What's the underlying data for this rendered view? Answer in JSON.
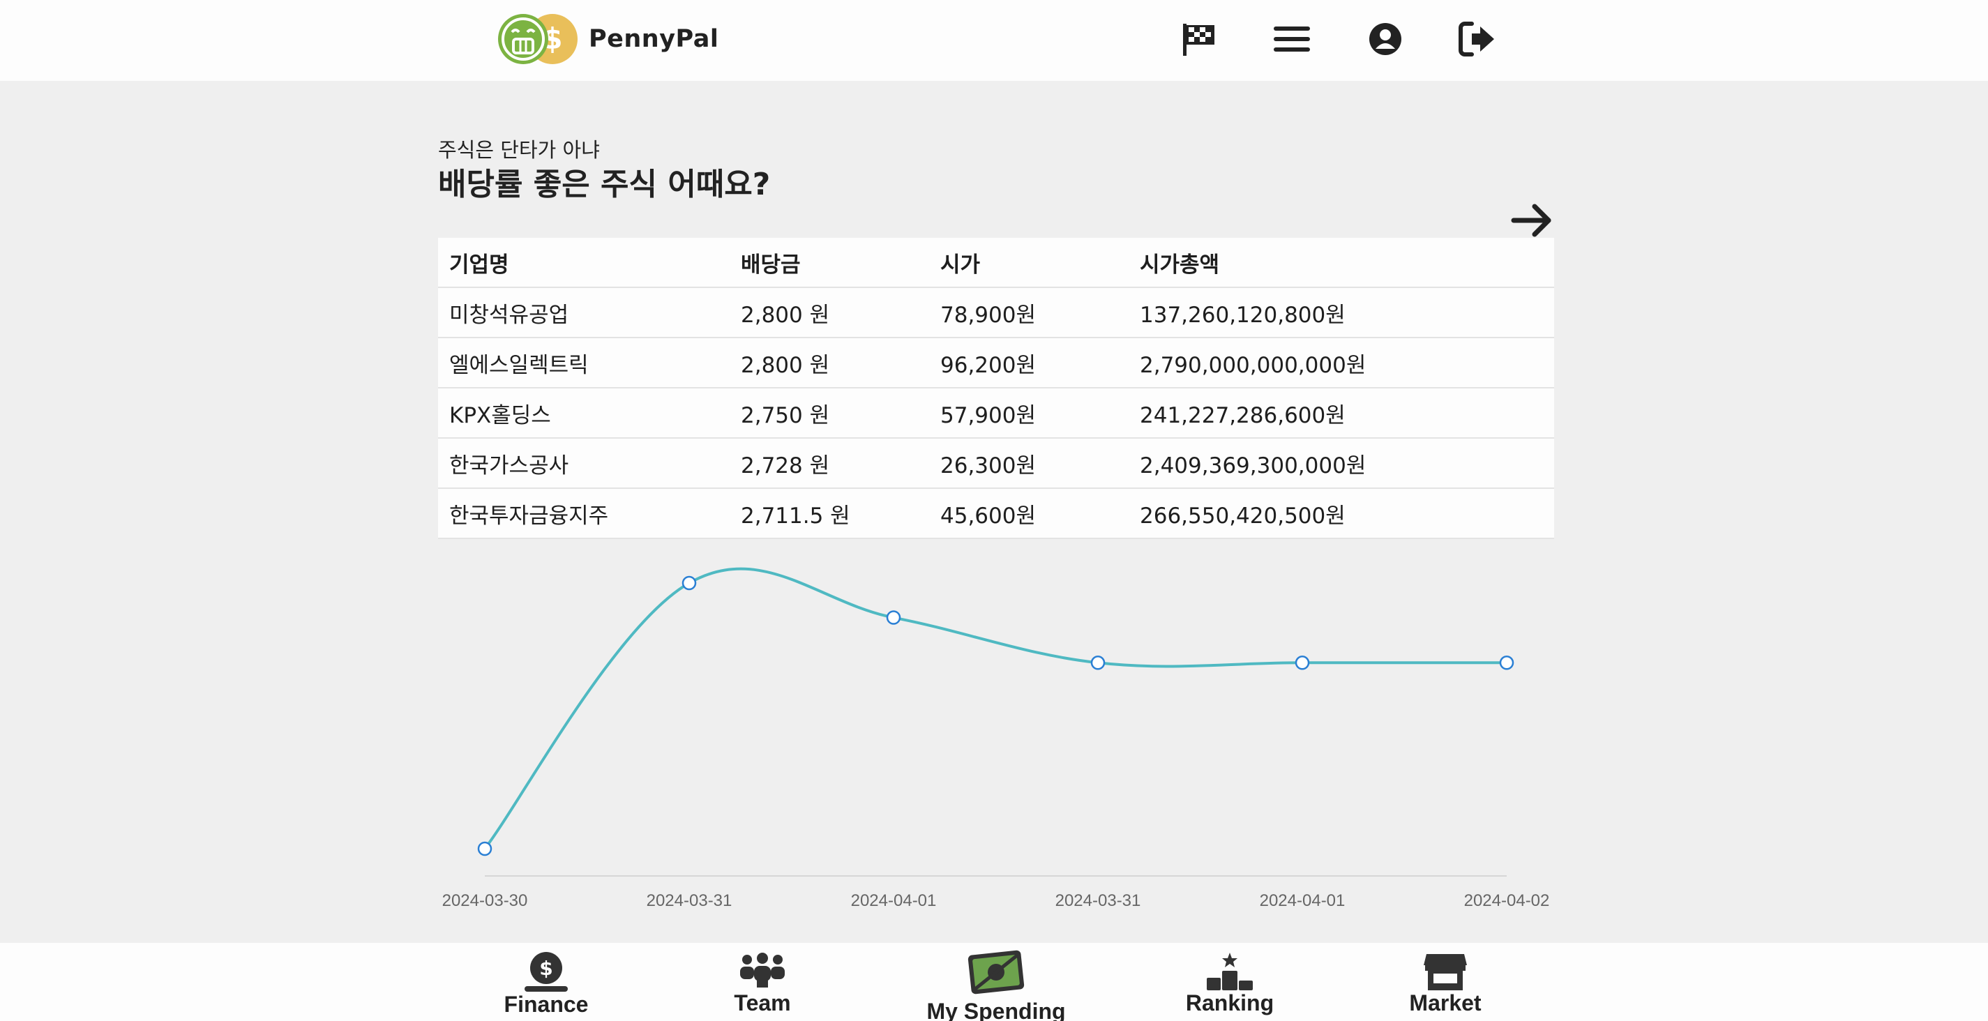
{
  "app": {
    "name": "PennyPal"
  },
  "header": {
    "icons": [
      "checkered-flag-icon",
      "menu-icon",
      "user-circle-icon",
      "logout-icon"
    ]
  },
  "section": {
    "subtitle": "주식은 단타가 아냐",
    "title": "배당률 좋은 주식 어때요?",
    "next_icon": "arrow-right-icon"
  },
  "table": {
    "headers": [
      "기업명",
      "배당금",
      "시가",
      "시가총액"
    ],
    "rows": [
      [
        "미창석유공업",
        "2,800 원",
        "78,900원",
        "137,260,120,800원"
      ],
      [
        "엘에스일렉트릭",
        "2,800 원",
        "96,200원",
        "2,790,000,000,000원"
      ],
      [
        "KPX홀딩스",
        "2,750 원",
        "57,900원",
        "241,227,286,600원"
      ],
      [
        "한국가스공사",
        "2,728 원",
        "26,300원",
        "2,409,369,300,000원"
      ],
      [
        "한국투자금융지주",
        "2,711.5 원",
        "45,600원",
        "266,550,420,500원"
      ]
    ]
  },
  "chart_data": {
    "type": "line",
    "categories": [
      "2024-03-30",
      "2024-03-31",
      "2024-04-01",
      "2024-03-31",
      "2024-04-01",
      "2024-04-02"
    ],
    "values": [
      0,
      100,
      87,
      70,
      70,
      70
    ],
    "ylim": [
      0,
      100
    ],
    "grid": false,
    "line_color": "#4fb9c2",
    "marker_color": "#2a7fd4"
  },
  "bottom_nav": [
    {
      "label": "Finance",
      "icon": "dollar-coin-icon"
    },
    {
      "label": "Team",
      "icon": "team-icon"
    },
    {
      "label": "My Spending",
      "icon": "money-bill-icon"
    },
    {
      "label": "Ranking",
      "icon": "podium-icon"
    },
    {
      "label": "Market",
      "icon": "store-icon"
    }
  ],
  "colors": {
    "background": "#efefef",
    "surface": "#fdfdfd",
    "logo_green": "#7cb342",
    "logo_yellow": "#e9bf5a",
    "text": "#1e1e1e"
  }
}
